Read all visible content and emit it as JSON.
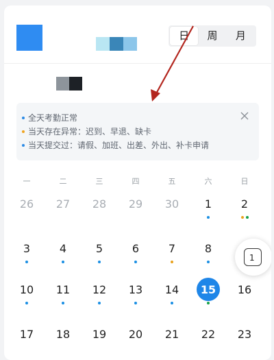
{
  "view_switcher": {
    "options": [
      "日",
      "周",
      "月"
    ],
    "selected": "日"
  },
  "legend": {
    "items": [
      {
        "text": "全天考勤正常",
        "color": "#2b8ae5"
      },
      {
        "text": "当天存在异常：迟到、早退、缺卡",
        "color": "#f0a31d"
      },
      {
        "text": "当天提交过：请假、加班、出差、外出、补卡申请",
        "color": "#2b8ae5"
      }
    ]
  },
  "calendar": {
    "weekdays": [
      "一",
      "二",
      "三",
      "四",
      "五",
      "六",
      "日"
    ],
    "weeks": [
      [
        {
          "d": "26",
          "muted": true,
          "dots": []
        },
        {
          "d": "27",
          "muted": true,
          "dots": []
        },
        {
          "d": "28",
          "muted": true,
          "dots": []
        },
        {
          "d": "29",
          "muted": true,
          "dots": []
        },
        {
          "d": "30",
          "muted": true,
          "dots": []
        },
        {
          "d": "1",
          "muted": false,
          "dots": [
            "#1a8fe3"
          ]
        },
        {
          "d": "2",
          "muted": false,
          "dots": [
            "#e8a21d",
            "#17a04a"
          ]
        }
      ],
      [
        {
          "d": "3",
          "muted": false,
          "dots": [
            "#1a8fe3"
          ]
        },
        {
          "d": "4",
          "muted": false,
          "dots": [
            "#1a8fe3"
          ]
        },
        {
          "d": "5",
          "muted": false,
          "dots": [
            "#1a8fe3"
          ]
        },
        {
          "d": "6",
          "muted": false,
          "dots": [
            "#1a8fe3"
          ]
        },
        {
          "d": "7",
          "muted": false,
          "dots": [
            "#e8a21d"
          ]
        },
        {
          "d": "8",
          "muted": false,
          "dots": [
            "#1a8fe3"
          ]
        },
        {
          "d": "",
          "muted": false,
          "dots": []
        }
      ],
      [
        {
          "d": "10",
          "muted": false,
          "dots": [
            "#1a8fe3"
          ]
        },
        {
          "d": "11",
          "muted": false,
          "dots": [
            "#1a8fe3"
          ]
        },
        {
          "d": "12",
          "muted": false,
          "dots": [
            "#1a8fe3"
          ]
        },
        {
          "d": "13",
          "muted": false,
          "dots": [
            "#1a8fe3"
          ]
        },
        {
          "d": "14",
          "muted": false,
          "dots": [
            "#1a8fe3"
          ]
        },
        {
          "d": "15",
          "muted": false,
          "today": true,
          "dots": [
            "#17a04a"
          ]
        },
        {
          "d": "16",
          "muted": false,
          "dots": []
        }
      ],
      [
        {
          "d": "17",
          "muted": false,
          "dots": []
        },
        {
          "d": "18",
          "muted": false,
          "dots": []
        },
        {
          "d": "19",
          "muted": false,
          "dots": []
        },
        {
          "d": "20",
          "muted": false,
          "dots": []
        },
        {
          "d": "21",
          "muted": false,
          "dots": []
        },
        {
          "d": "22",
          "muted": false,
          "dots": []
        },
        {
          "d": "23",
          "muted": false,
          "dots": []
        }
      ]
    ]
  },
  "floating_button": {
    "label": "1"
  },
  "colors": {
    "accent": "#1f86e8",
    "annotation_arrow": "#b3261e"
  },
  "icons": {
    "close": "close-icon",
    "floating": "calendar-jump-icon"
  }
}
